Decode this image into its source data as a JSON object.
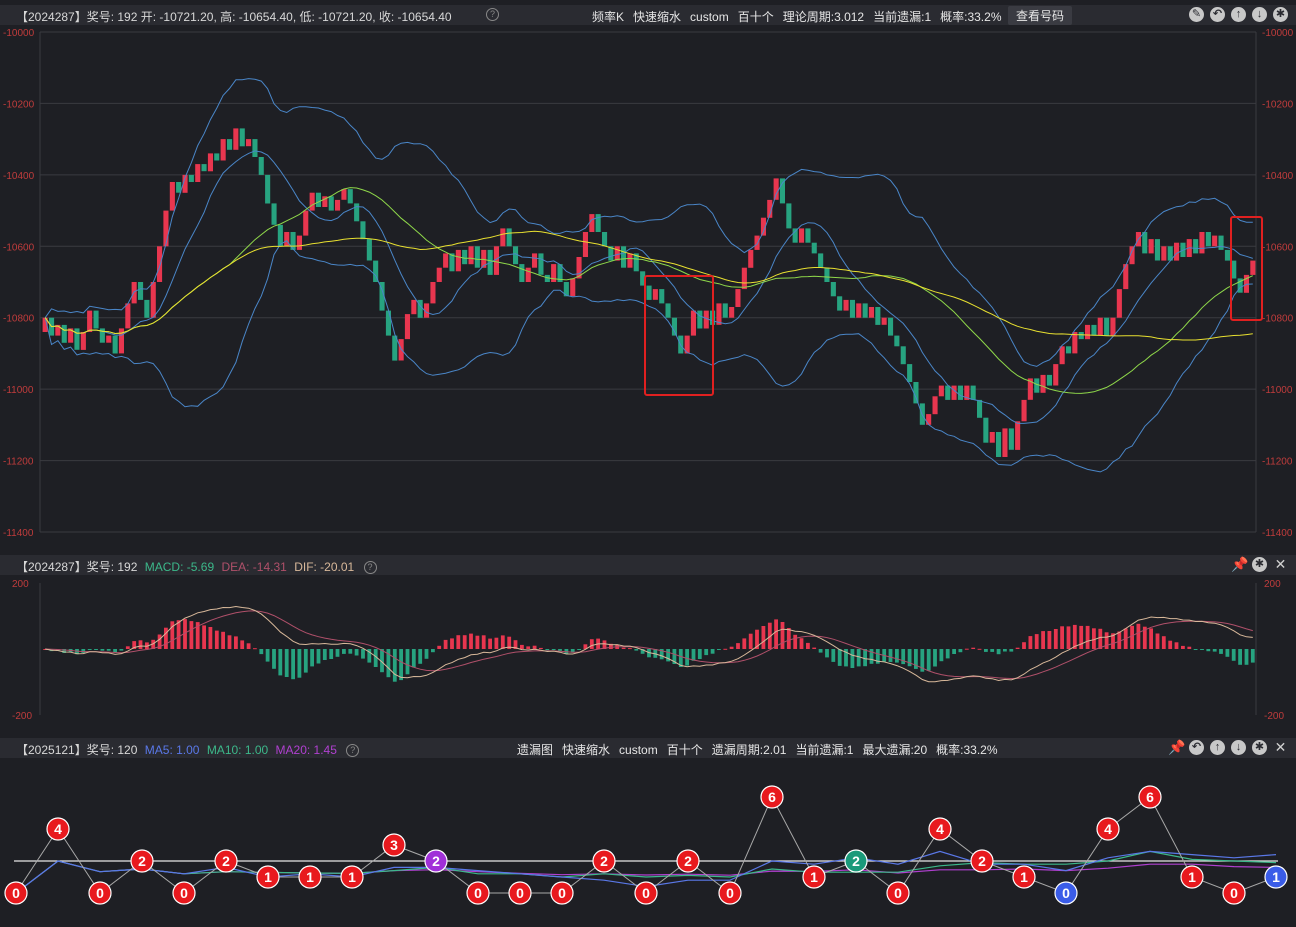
{
  "main_header": {
    "left": "【2024287】奖号: 192   开: -10721.20, 高: -10654.40, 低: -10721.20, 收: -10654.40",
    "center": [
      "频率K",
      "快速缩水",
      "custom",
      "百十个",
      "理论周期:3.012",
      "当前遗漏:1",
      "概率:33.2%"
    ],
    "button": "查看号码",
    "icons": [
      "edit-icon",
      "undo-icon",
      "up-icon",
      "down-icon",
      "settings-icon"
    ]
  },
  "macd_header": {
    "prefix": "【2024287】奖号: 192",
    "macd": "MACD: -5.69",
    "dea": "DEA: -14.31",
    "dif": "DIF: -20.01",
    "colors": {
      "macd": "#3cb88a",
      "dea": "#b0506a",
      "dif": "#d8b89a"
    }
  },
  "bottom_header": {
    "prefix": "【2025121】奖号: 120",
    "ma5": "MA5: 1.00",
    "ma10": "MA10: 1.00",
    "ma20": "MA20: 1.45",
    "center": [
      "遗漏图",
      "快速缩水",
      "custom",
      "百十个",
      "遗漏周期:2.01",
      "当前遗漏:1",
      "最大遗漏:20",
      "概率:33.2%"
    ],
    "colors": {
      "ma5": "#5a78e8",
      "ma10": "#3cb88a",
      "ma20": "#b040d0"
    }
  },
  "chart_data": [
    {
      "type": "candlestick",
      "yticks": [
        "-10000",
        "-10200",
        "-10400",
        "-10600",
        "-10800",
        "-11000",
        "-11200",
        "-11400"
      ],
      "ylim": [
        -11400,
        -10000
      ],
      "up_color": "#e8364f",
      "down_color": "#27a380",
      "close": [
        -10800,
        -10850,
        -10820,
        -10870,
        -10830,
        -10890,
        -10840,
        -10780,
        -10830,
        -10870,
        -10850,
        -10900,
        -10830,
        -10760,
        -10700,
        -10750,
        -10800,
        -10700,
        -10600,
        -10500,
        -10420,
        -10450,
        -10400,
        -10420,
        -10370,
        -10390,
        -10340,
        -10360,
        -10300,
        -10330,
        -10270,
        -10320,
        -10300,
        -10350,
        -10400,
        -10480,
        -10540,
        -10600,
        -10560,
        -10610,
        -10570,
        -10500,
        -10450,
        -10490,
        -10460,
        -10500,
        -10470,
        -10440,
        -10480,
        -10530,
        -10580,
        -10640,
        -10700,
        -10780,
        -10850,
        -10920,
        -10860,
        -10790,
        -10750,
        -10800,
        -10760,
        -10700,
        -10660,
        -10620,
        -10670,
        -10610,
        -10650,
        -10600,
        -10660,
        -10610,
        -10680,
        -10600,
        -10550,
        -10600,
        -10650,
        -10700,
        -10660,
        -10620,
        -10680,
        -10700,
        -10650,
        -10700,
        -10740,
        -10690,
        -10630,
        -10560,
        -10510,
        -10560,
        -10600,
        -10640,
        -10600,
        -10660,
        -10620,
        -10670,
        -10710,
        -10750,
        -10720,
        -10760,
        -10800,
        -10850,
        -10900,
        -10850,
        -10780,
        -10830,
        -10780,
        -10820,
        -10760,
        -10800,
        -10770,
        -10720,
        -10660,
        -10610,
        -10570,
        -10520,
        -10470,
        -10410,
        -10480,
        -10550,
        -10590,
        -10550,
        -10590,
        -10620,
        -10660,
        -10700,
        -10740,
        -10780,
        -10750,
        -10800,
        -10760,
        -10800,
        -10770,
        -10820,
        -10800,
        -10850,
        -10880,
        -10930,
        -10980,
        -11040,
        -11100,
        -11070,
        -11020,
        -10990,
        -11030,
        -10990,
        -11030,
        -10990,
        -11030,
        -11080,
        -11150,
        -11120,
        -11190,
        -11110,
        -11170,
        -11090,
        -11030,
        -10970,
        -11010,
        -10960,
        -10990,
        -10930,
        -10880,
        -10900,
        -10840,
        -10860,
        -10820,
        -10850,
        -10800,
        -10850,
        -10800,
        -10720,
        -10650,
        -10600,
        -10560,
        -10620,
        -10580,
        -10640,
        -10600,
        -10640,
        -10590,
        -10630,
        -10580,
        -10620,
        -10560,
        -10600,
        -10570,
        -10610,
        -10640,
        -10690,
        -10730,
        -10680,
        -10640
      ]
    },
    {
      "type": "bar+line",
      "yticks": [
        "200",
        "-200"
      ],
      "ylim": [
        -200,
        200
      ],
      "series": [
        {
          "name": "MACD"
        },
        {
          "name": "DEA"
        },
        {
          "name": "DIF"
        }
      ]
    },
    {
      "type": "line",
      "series": [
        {
          "name": "MA5"
        },
        {
          "name": "MA10"
        },
        {
          "name": "MA20"
        }
      ],
      "points": [
        {
          "v": "0",
          "c": "#e8191e"
        },
        {
          "v": "4",
          "c": "#e8191e"
        },
        {
          "v": "0",
          "c": "#e8191e"
        },
        {
          "v": "2",
          "c": "#e8191e"
        },
        {
          "v": "0",
          "c": "#e8191e"
        },
        {
          "v": "2",
          "c": "#e8191e"
        },
        {
          "v": "1",
          "c": "#e8191e"
        },
        {
          "v": "1",
          "c": "#e8191e"
        },
        {
          "v": "1",
          "c": "#e8191e"
        },
        {
          "v": "3",
          "c": "#e8191e"
        },
        {
          "v": "2",
          "c": "#a030d8"
        },
        {
          "v": "0",
          "c": "#e8191e"
        },
        {
          "v": "0",
          "c": "#e8191e"
        },
        {
          "v": "0",
          "c": "#e8191e"
        },
        {
          "v": "2",
          "c": "#e8191e"
        },
        {
          "v": "0",
          "c": "#e8191e"
        },
        {
          "v": "2",
          "c": "#e8191e"
        },
        {
          "v": "0",
          "c": "#e8191e"
        },
        {
          "v": "6",
          "c": "#e8191e"
        },
        {
          "v": "1",
          "c": "#e8191e"
        },
        {
          "v": "2",
          "c": "#1a9a7a"
        },
        {
          "v": "0",
          "c": "#e8191e"
        },
        {
          "v": "4",
          "c": "#e8191e"
        },
        {
          "v": "2",
          "c": "#e8191e"
        },
        {
          "v": "1",
          "c": "#e8191e"
        },
        {
          "v": "0",
          "c": "#3a5ce8"
        },
        {
          "v": "4",
          "c": "#e8191e"
        },
        {
          "v": "6",
          "c": "#e8191e"
        },
        {
          "v": "1",
          "c": "#e8191e"
        },
        {
          "v": "0",
          "c": "#e8191e"
        },
        {
          "v": "1",
          "c": "#3a5ce8"
        }
      ]
    }
  ]
}
